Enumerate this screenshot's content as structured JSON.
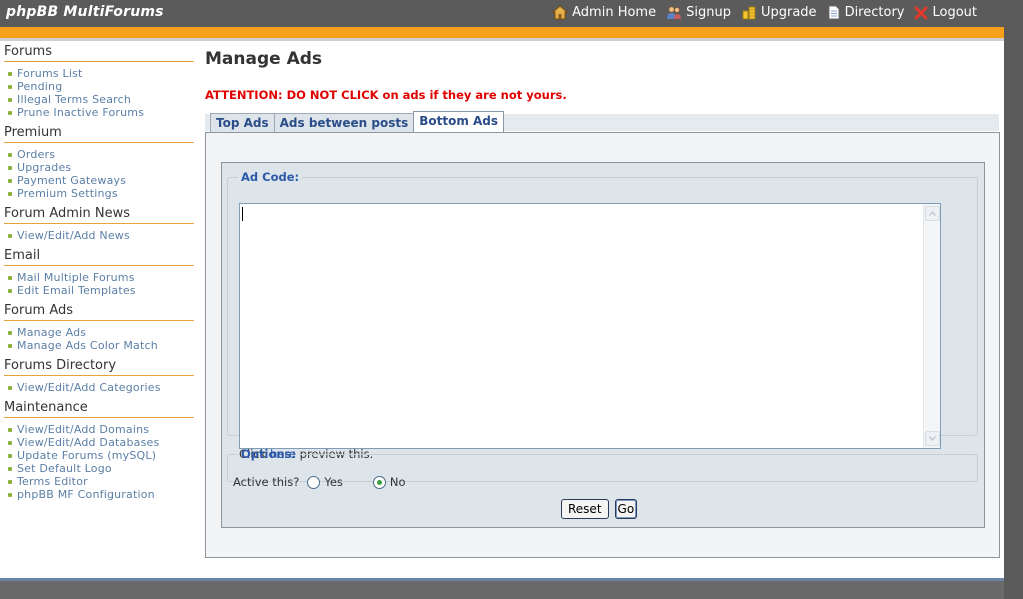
{
  "header": {
    "brand": "phpBB MultiForums",
    "nav": [
      {
        "label": "Admin Home",
        "icon": "home-icon"
      },
      {
        "label": "Signup",
        "icon": "users-icon"
      },
      {
        "label": "Upgrade",
        "icon": "coins-icon"
      },
      {
        "label": "Directory",
        "icon": "document-icon"
      },
      {
        "label": "Logout",
        "icon": "logout-x-icon"
      }
    ]
  },
  "sidebar": {
    "sections": [
      {
        "title": "Forums",
        "items": [
          "Forums List",
          "Pending",
          "Illegal Terms Search",
          "Prune Inactive Forums"
        ]
      },
      {
        "title": "Premium",
        "items": [
          "Orders",
          "Upgrades",
          "Payment Gateways",
          "Premium Settings"
        ]
      },
      {
        "title": "Forum Admin News",
        "items": [
          "View/Edit/Add News"
        ]
      },
      {
        "title": "Email",
        "items": [
          "Mail Multiple Forums",
          "Edit Email Templates"
        ]
      },
      {
        "title": "Forum Ads",
        "items": [
          "Manage Ads",
          "Manage Ads Color Match"
        ]
      },
      {
        "title": "Forums Directory",
        "items": [
          "View/Edit/Add Categories"
        ]
      },
      {
        "title": "Maintenance",
        "items": [
          "View/Edit/Add Domains",
          "View/Edit/Add Databases",
          "Update Forums (mySQL)",
          "Set Default Logo",
          "Terms Editor",
          "phpBB MF Configuration"
        ]
      }
    ]
  },
  "main": {
    "title": "Manage Ads",
    "attention": "ATTENTION: DO NOT CLICK on ads if they are not yours.",
    "tabs": [
      {
        "label": "Top Ads",
        "active": false
      },
      {
        "label": "Ads between posts",
        "active": false
      },
      {
        "label": "Bottom Ads",
        "active": true
      }
    ],
    "form": {
      "ad_code_legend": "Ad Code:",
      "ad_code_value": "",
      "preview_prefix": "Click ",
      "preview_link": "here",
      "preview_suffix": " preview this.",
      "options_legend": "Options:",
      "active_label": "Active this?",
      "yes_label": "Yes",
      "no_label": "No",
      "active_selected": "No",
      "reset_label": "Reset",
      "go_label": "Go"
    }
  },
  "colors": {
    "accent_orange": "#f7a01a",
    "header_gray": "#5b5b5b",
    "link_blue": "#5b7fa6",
    "attention_red": "#e00000"
  }
}
